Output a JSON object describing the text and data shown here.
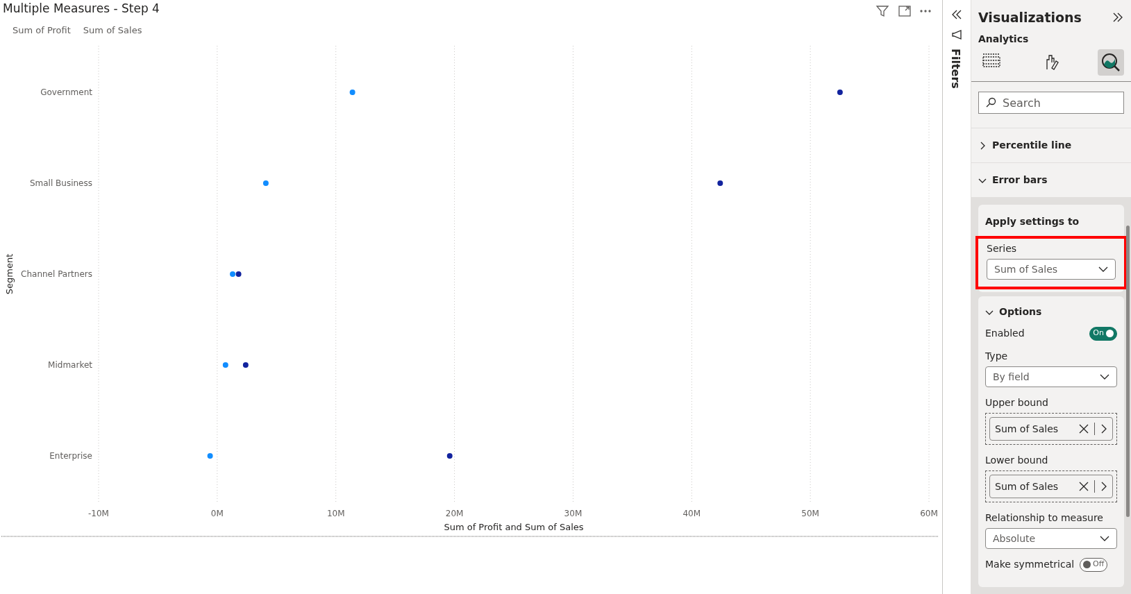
{
  "visual": {
    "title": "Multiple Measures - Step 4",
    "chart_data": {
      "type": "scatter",
      "orientation": "horizontal",
      "grid": true,
      "ylabel": "Segment",
      "xlabel": "Sum of Profit and Sum of Sales",
      "categories": [
        "Government",
        "Small Business",
        "Channel Partners",
        "Midmarket",
        "Enterprise"
      ],
      "series": [
        {
          "name": "Sum of Profit",
          "color": "#118dff",
          "values": [
            11.4,
            4.1,
            1.3,
            0.7,
            -0.6
          ]
        },
        {
          "name": "Sum of Sales",
          "color": "#12239e",
          "values": [
            52.5,
            42.4,
            1.8,
            2.4,
            19.6
          ]
        }
      ],
      "xlim": [
        -10,
        60
      ],
      "xticks": [
        {
          "value": -10,
          "label": "-10M"
        },
        {
          "value": 0,
          "label": "0M"
        },
        {
          "value": 10,
          "label": "10M"
        },
        {
          "value": 20,
          "label": "20M"
        },
        {
          "value": 30,
          "label": "30M"
        },
        {
          "value": 40,
          "label": "40M"
        },
        {
          "value": 50,
          "label": "50M"
        },
        {
          "value": 60,
          "label": "60M"
        }
      ]
    }
  },
  "filters_pane": {
    "title": "Filters"
  },
  "visualizations_pane": {
    "title": "Visualizations",
    "subtitle": "Analytics",
    "tabs": [
      {
        "selected": false
      },
      {
        "selected": false
      },
      {
        "selected": true
      }
    ],
    "search": {
      "placeholder": "Search"
    },
    "sections": [
      {
        "label": "Percentile line",
        "expanded": false
      },
      {
        "label": "Error bars",
        "expanded": true
      }
    ],
    "apply_settings": {
      "heading": "Apply settings to",
      "series_label": "Series",
      "series_value": "Sum of Sales",
      "highlighted": true
    },
    "options": {
      "label": "Options",
      "expanded": true,
      "rows": [
        {
          "kind": "toggle",
          "label": "Enabled",
          "on": true,
          "state_text": "On"
        },
        {
          "kind": "dropdown",
          "label": "Type",
          "value": "By field"
        },
        {
          "kind": "well",
          "label": "Upper bound",
          "value": "Sum of Sales"
        },
        {
          "kind": "well",
          "label": "Lower bound",
          "value": "Sum of Sales"
        },
        {
          "kind": "dropdown",
          "label": "Relationship to measure",
          "value": "Absolute"
        },
        {
          "kind": "toggle",
          "label": "Make symmetrical",
          "on": false,
          "state_text": "Off"
        }
      ]
    }
  }
}
